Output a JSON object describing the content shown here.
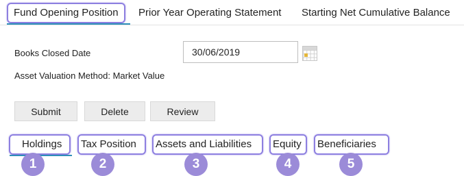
{
  "tabs": [
    {
      "label": "Fund Opening Position",
      "active": true
    },
    {
      "label": "Prior Year Operating Statement",
      "active": false
    },
    {
      "label": "Starting Net Cumulative Balance",
      "active": false
    }
  ],
  "form": {
    "books_closed_label": "Books Closed Date",
    "books_closed_value": "30/06/2019",
    "asset_valuation_text": "Asset Valuation Method: Market Value"
  },
  "buttons": {
    "submit": "Submit",
    "delete": "Delete",
    "review": "Review"
  },
  "subtabs": [
    {
      "label": "Holdings",
      "badge": "1"
    },
    {
      "label": "Tax Position",
      "badge": "2"
    },
    {
      "label": "Assets and Liabilities",
      "badge": "3"
    },
    {
      "label": "Equity",
      "badge": "4"
    },
    {
      "label": "Beneficiaries",
      "badge": "5"
    }
  ],
  "colors": {
    "accent_underline": "#2d8fb9",
    "highlight_border": "#8d7fe0",
    "badge": "#9b8bd8"
  },
  "icons": {
    "calendar": "calendar-icon"
  }
}
